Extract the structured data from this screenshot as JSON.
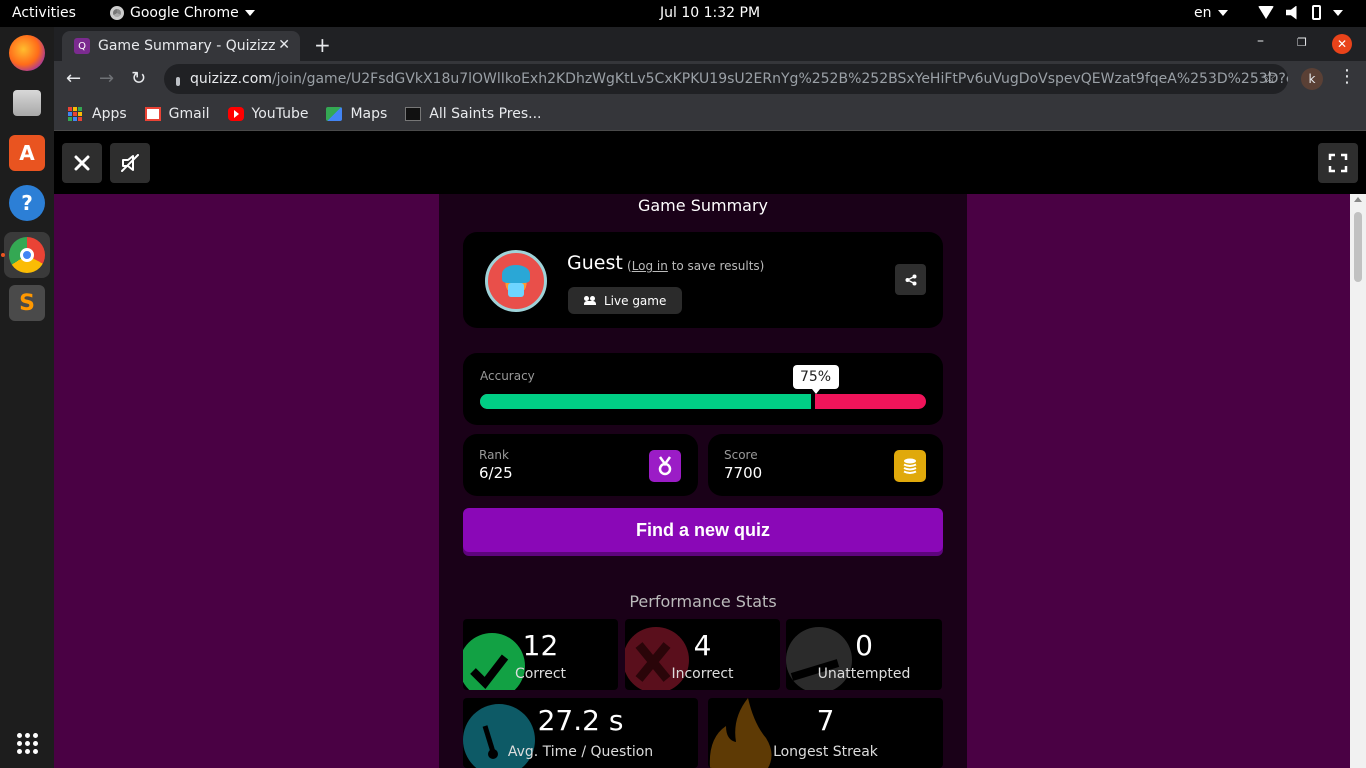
{
  "topbar": {
    "activities": "Activities",
    "app_name": "Google Chrome",
    "clock": "Jul 10  1:32 PM",
    "lang": "en"
  },
  "dock": {
    "items": [
      "firefox-icon",
      "files-icon",
      "software-center-icon",
      "help-icon",
      "chrome-icon",
      "sublime-text-icon",
      "show-apps-icon"
    ]
  },
  "browser": {
    "tab_title": "Game Summary - Quizizz",
    "url_host": "quizizz.com",
    "url_path": "/join/game/U2FsdGVkX18u7lOWlIkoExh2KDhzWgKtLv5CxKPKU19sU2ERnYg%252B%252BSxYeHiFtPv6uVugDoVspevQEWzat9fqeA%253D%253D?gam...",
    "profile_initial": "k",
    "bookmarks": [
      "Apps",
      "Gmail",
      "YouTube",
      "Maps",
      "All Saints Pres..."
    ]
  },
  "summary": {
    "title": "Game Summary",
    "player_name": "Guest",
    "login_prefix": "(",
    "login_link": "Log in",
    "login_suffix": " to save results)",
    "mode": "Live game",
    "accuracy_label": "Accuracy",
    "accuracy_percent": 75,
    "accuracy_text": "75%",
    "rank_label": "Rank",
    "rank_value": "6/25",
    "score_label": "Score",
    "score_value": "7700",
    "find_button": "Find a new quiz"
  },
  "performance": {
    "title": "Performance Stats",
    "correct": {
      "value": "12",
      "label": "Correct"
    },
    "incorrect": {
      "value": "4",
      "label": "Incorrect"
    },
    "unattempted": {
      "value": "0",
      "label": "Unattempted"
    },
    "avg_time": {
      "value": "27.2 s",
      "label": "Avg. Time / Question"
    },
    "streak": {
      "value": "7",
      "label": "Longest Streak"
    }
  },
  "colors": {
    "page_bg": "#4a0144",
    "accuracy_correct": "#00cf85",
    "accuracy_incorrect": "#f0145a",
    "primary_button": "#8a08b7"
  }
}
